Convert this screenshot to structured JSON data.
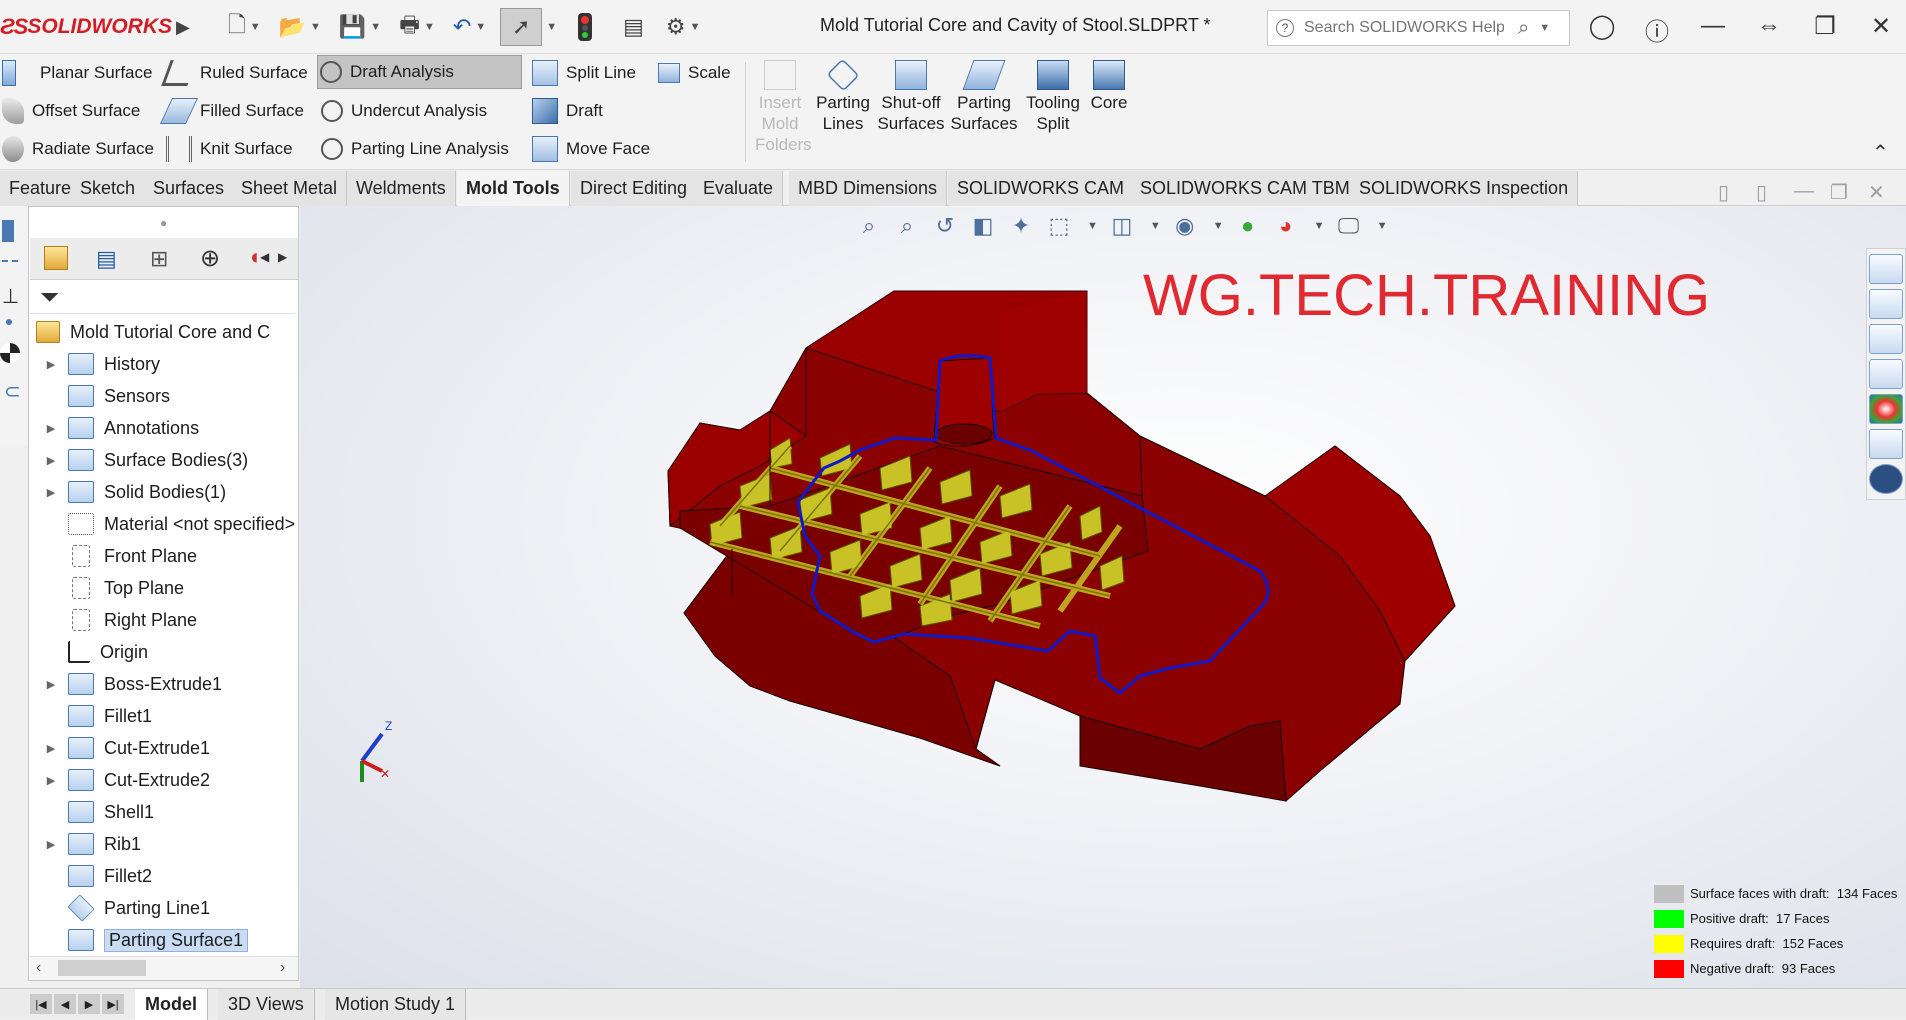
{
  "titlebar": {
    "brand": "SOLIDWORKS",
    "document_title": "Mold Tutorial Core and Cavity of Stool.SLDPRT *",
    "search_placeholder": "Search SOLIDWORKS Help"
  },
  "ribbon": {
    "surface_buttons": [
      "Planar Surface",
      "Offset Surface",
      "Radiate Surface",
      "Ruled Surface",
      "Filled Surface",
      "Knit Surface"
    ],
    "analysis_buttons": [
      "Draft Analysis",
      "Undercut Analysis",
      "Parting Line Analysis"
    ],
    "edit_buttons": [
      "Split Line",
      "Draft",
      "Move Face",
      "Scale"
    ],
    "mold_buttons": [
      {
        "line1": "Insert",
        "line2": "Mold",
        "line3": "Folders"
      },
      {
        "line1": "Parting",
        "line2": "Lines",
        "line3": ""
      },
      {
        "line1": "Shut-off",
        "line2": "Surfaces",
        "line3": ""
      },
      {
        "line1": "Parting",
        "line2": "Surfaces",
        "line3": ""
      },
      {
        "line1": "Tooling",
        "line2": "Split",
        "line3": ""
      },
      {
        "line1": "Core",
        "line2": "",
        "line3": ""
      }
    ]
  },
  "tabs": [
    "Features",
    "Sketch",
    "Surfaces",
    "Sheet Metal",
    "Weldments",
    "Mold Tools",
    "Direct Editing",
    "Evaluate",
    "MBD Dimensions",
    "SOLIDWORKS CAM",
    "SOLIDWORKS CAM TBM",
    "SOLIDWORKS Inspection"
  ],
  "active_tab": "Mold Tools",
  "feature_tree": {
    "root": "Mold Tutorial Core and Cavity",
    "items": [
      "History",
      "Sensors",
      "Annotations",
      "Surface Bodies(3)",
      "Solid Bodies(1)",
      "Material <not specified>",
      "Front Plane",
      "Top Plane",
      "Right Plane",
      "Origin",
      "Boss-Extrude1",
      "Fillet1",
      "Cut-Extrude1",
      "Cut-Extrude2",
      "Shell1",
      "Rib1",
      "Fillet2",
      "Parting Line1",
      "Parting Surface1"
    ]
  },
  "viewport": {
    "watermark": "WG.TECH.TRAINING",
    "triad": {
      "z": "Z"
    }
  },
  "legend": [
    {
      "label": "Surface faces with draft:",
      "count": "134 Faces",
      "color": "#c0c0c0"
    },
    {
      "label": "Positive draft:",
      "count": "17 Faces",
      "color": "#00ff00"
    },
    {
      "label": "Requires draft:",
      "count": "152 Faces",
      "color": "#ffff00"
    },
    {
      "label": "Negative draft:",
      "count": "93 Faces",
      "color": "#ff0000"
    }
  ],
  "bottom_tabs": [
    "Model",
    "3D Views",
    "Motion Study 1"
  ],
  "active_bottom_tab": "Model"
}
